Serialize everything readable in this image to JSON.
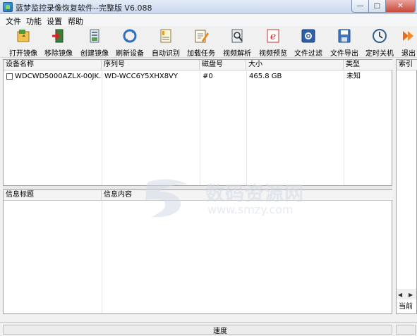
{
  "window": {
    "title": "蓝梦监控录像恢复软件--完整版 V6.088"
  },
  "menu": [
    "文件",
    "功能",
    "设置",
    "帮助"
  ],
  "toolbar": [
    {
      "label": "打开镜像",
      "icon": "open-image-icon"
    },
    {
      "label": "移除镜像",
      "icon": "remove-image-icon"
    },
    {
      "label": "创建镜像",
      "icon": "create-image-icon"
    },
    {
      "label": "刷新设备",
      "icon": "refresh-icon"
    },
    {
      "label": "自动识别",
      "icon": "auto-detect-icon"
    },
    {
      "label": "加载任务",
      "icon": "load-task-icon"
    },
    {
      "label": "视频解析",
      "icon": "video-parse-icon"
    },
    {
      "label": "视频预览",
      "icon": "video-preview-icon"
    },
    {
      "label": "文件过滤",
      "icon": "file-filter-icon"
    },
    {
      "label": "文件导出",
      "icon": "file-export-icon"
    },
    {
      "label": "定时关机",
      "icon": "timer-shutdown-icon"
    },
    {
      "label": "退出",
      "icon": "exit-icon"
    }
  ],
  "device_table": {
    "headers": [
      "设备名称",
      "序列号",
      "磁盘号",
      "大小",
      "类型"
    ],
    "rows": [
      {
        "name": "WDCWD5000AZLX-00JK...",
        "serial": "WD-WCC6Y5XHX8VY",
        "disk": "#0",
        "size": "465.8 GB",
        "type": "未知"
      }
    ]
  },
  "info_table": {
    "headers": [
      "信息标题",
      "信息内容"
    ]
  },
  "right_panel": {
    "header": "索引",
    "footer": "当前"
  },
  "status": {
    "progress_label": "速度"
  },
  "watermark": {
    "text": "数码资源网",
    "url": "www.smzy.com"
  }
}
